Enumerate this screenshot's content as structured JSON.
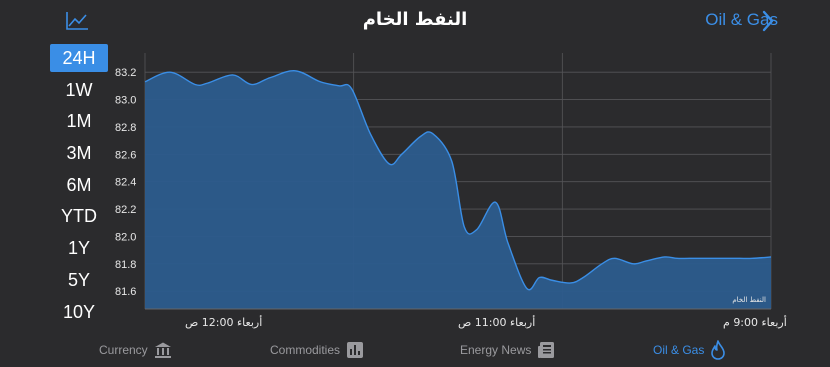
{
  "header": {
    "title": "النفط الخام",
    "back_label": "Oil & Gas",
    "chart_icon": "line-chart-icon",
    "back_icon": "chevron-right-icon"
  },
  "ranges": {
    "items": [
      "24H",
      "1W",
      "1M",
      "3M",
      "6M",
      "YTD",
      "1Y",
      "5Y",
      "10Y"
    ],
    "selected": "24H"
  },
  "chart_data": {
    "type": "area",
    "watermark": "النفط الخام",
    "ylim": [
      81.47,
      83.34
    ],
    "yticks": [
      "83.2",
      "83.0",
      "82.8",
      "82.6",
      "82.4",
      "82.2",
      "82.0",
      "81.8",
      "81.6"
    ],
    "xticks": [
      "أربعاء 12:00 ص",
      "أربعاء 11:00 ص",
      "أربعاء 9:00 م"
    ],
    "x": [
      0.0,
      0.04,
      0.08,
      0.1,
      0.14,
      0.17,
      0.2,
      0.24,
      0.28,
      0.31,
      0.33,
      0.36,
      0.39,
      0.41,
      0.44,
      0.46,
      0.49,
      0.51,
      0.53,
      0.56,
      0.58,
      0.61,
      0.63,
      0.65,
      0.68,
      0.7,
      0.73,
      0.75,
      0.78,
      0.8,
      0.83,
      0.85,
      0.87,
      0.9,
      0.93,
      0.95,
      0.97,
      1.0
    ],
    "values": [
      83.13,
      83.2,
      83.11,
      83.12,
      83.18,
      83.11,
      83.16,
      83.21,
      83.13,
      83.1,
      83.08,
      82.75,
      82.53,
      82.6,
      82.73,
      82.75,
      82.55,
      82.07,
      82.05,
      82.25,
      81.95,
      81.62,
      81.7,
      81.68,
      81.66,
      81.7,
      81.8,
      81.84,
      81.8,
      81.82,
      81.85,
      81.84,
      81.84,
      81.84,
      81.84,
      81.84,
      81.84,
      81.85
    ],
    "color": "#3a8ee6",
    "fill": "#2c5c8d",
    "grid": true
  },
  "tabs": [
    {
      "label": "Currency",
      "icon": "bank-icon",
      "active": false
    },
    {
      "label": "Commodities",
      "icon": "bar-chart-icon",
      "active": false
    },
    {
      "label": "Energy News",
      "icon": "newspaper-icon",
      "active": false
    },
    {
      "label": "Oil & Gas",
      "icon": "flame-icon",
      "active": true
    }
  ],
  "colors": {
    "accent": "#3a8ee6",
    "background": "#2b2b2d",
    "inactive": "#9a9a9e"
  }
}
